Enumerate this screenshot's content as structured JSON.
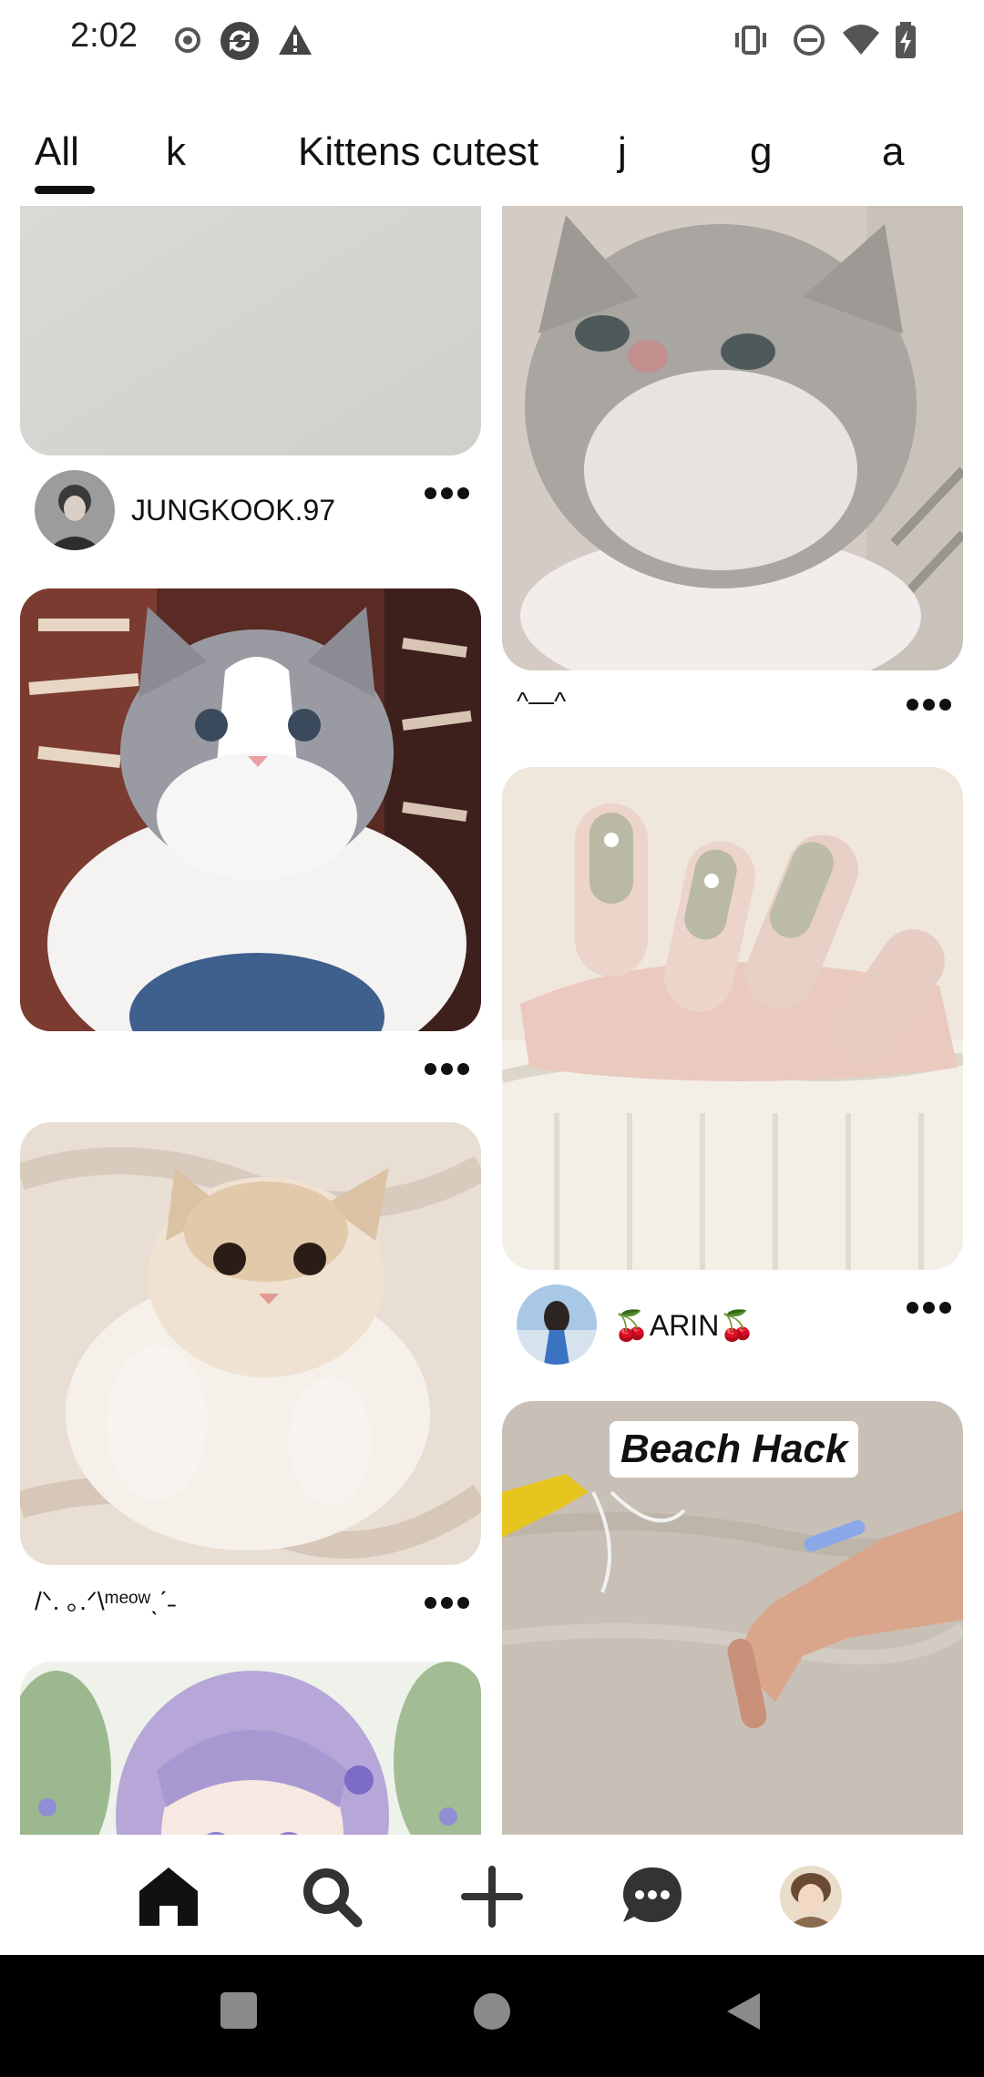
{
  "status_bar": {
    "time": "2:02",
    "left_icons": [
      "record-icon",
      "sync-icon",
      "warning-icon"
    ],
    "right_icons": [
      "vibrate-icon",
      "dnd-icon",
      "wifi-icon",
      "battery-charging-icon"
    ]
  },
  "tabs": [
    {
      "label": "All",
      "active": true
    },
    {
      "label": "k",
      "active": false
    },
    {
      "label": "Kittens cutest",
      "active": false
    },
    {
      "label": "j",
      "active": false
    },
    {
      "label": "g",
      "active": false
    },
    {
      "label": "a",
      "active": false
    }
  ],
  "feed": {
    "left_column": [
      {
        "kind": "blank-grey-card",
        "user": "JUNGKOOK.97"
      },
      {
        "kind": "ragdoll-kitten-photo"
      },
      {
        "kind": "cream-kitten-on-blanket",
        "caption": "/ᐠ. ｡.ᐟ\\ᵐᵉᵒʷˎˊ˗"
      },
      {
        "kind": "anime-girl-illustration"
      }
    ],
    "right_column": [
      {
        "kind": "grey-kitten-closeup",
        "caption": "^—^"
      },
      {
        "kind": "nail-art-photo",
        "user": "🍒ARIN🍒"
      },
      {
        "kind": "beach-video",
        "overlay": "Beach Hack"
      }
    ]
  },
  "bottom_nav": [
    {
      "name": "home",
      "icon": "home-icon",
      "active": true
    },
    {
      "name": "search",
      "icon": "search-icon",
      "active": false
    },
    {
      "name": "create",
      "icon": "plus-icon",
      "active": false
    },
    {
      "name": "messages",
      "icon": "chat-bubble-icon",
      "active": false
    },
    {
      "name": "profile",
      "icon": "avatar-icon",
      "active": false
    }
  ],
  "system_nav": [
    "recents-square-icon",
    "home-circle-icon",
    "back-triangle-icon"
  ],
  "colors": {
    "text": "#111111",
    "background": "#ffffff",
    "nav_icon": "#333333",
    "system_bar": "#000000"
  }
}
